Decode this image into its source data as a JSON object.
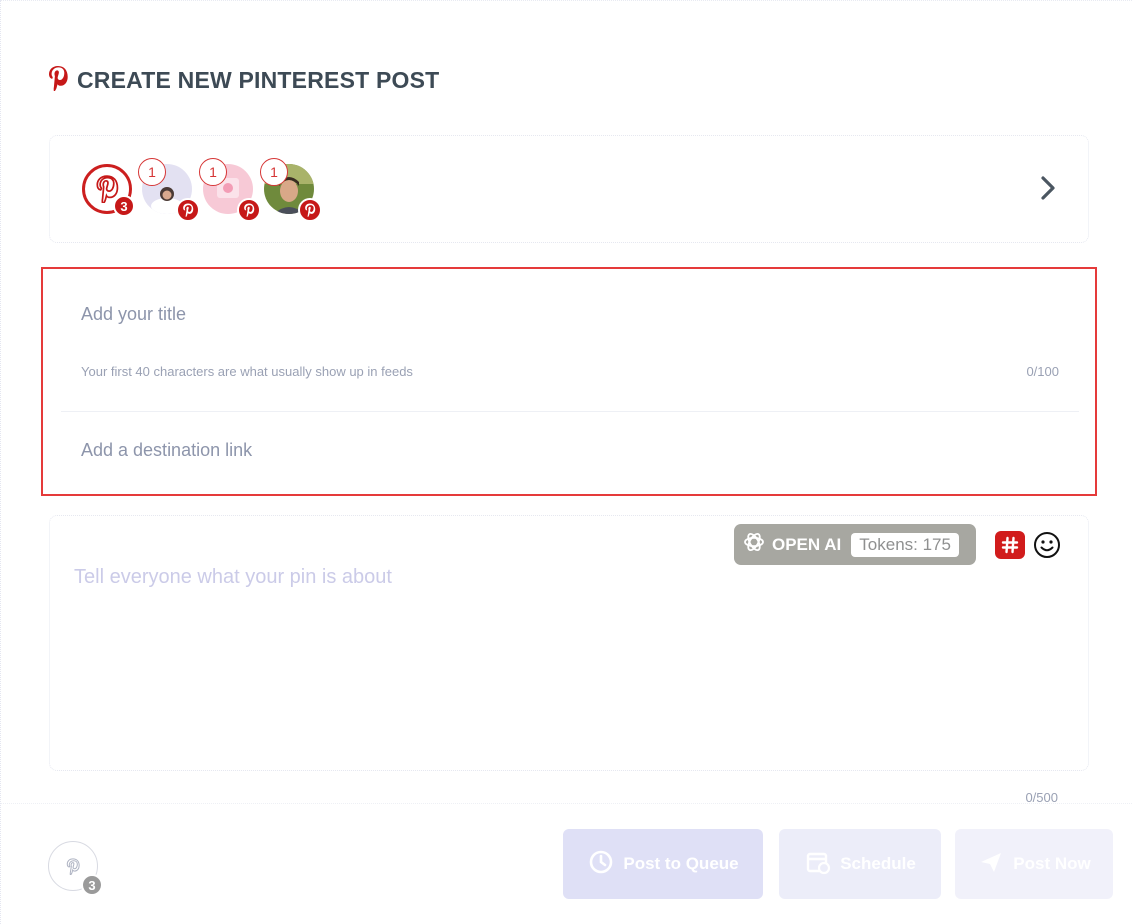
{
  "header": {
    "title": "CREATE NEW PINTEREST POST",
    "icon": "pinterest-icon",
    "accent": "#c61818"
  },
  "accounts": {
    "selected_count": "3",
    "items": [
      {
        "badge": "1",
        "network_icon": "pinterest-icon"
      },
      {
        "badge": "1",
        "network_icon": "pinterest-icon"
      },
      {
        "badge": "1",
        "network_icon": "pinterest-icon"
      }
    ]
  },
  "form": {
    "title_placeholder": "Add your title",
    "title_hint": "Your first 40 characters are what usually show up in feeds",
    "title_count": "0/100",
    "link_placeholder": "Add a destination link",
    "description_placeholder": "Tell everyone what your pin is about",
    "description_count": "0/500"
  },
  "toolbar": {
    "openai_label": "OPEN AI",
    "tokens_label": "Tokens: 175"
  },
  "footer": {
    "account_count": "3",
    "queue_label": "Post to Queue",
    "schedule_label": "Schedule",
    "post_now_label": "Post Now"
  }
}
